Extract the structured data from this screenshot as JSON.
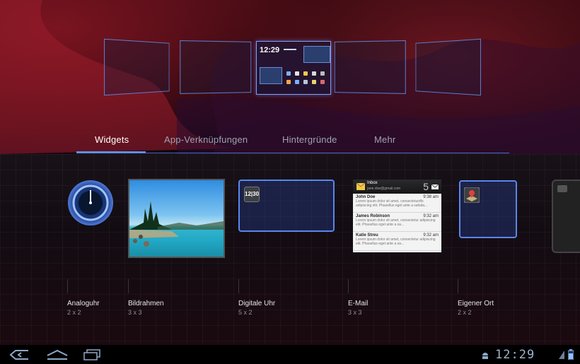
{
  "tabs": [
    {
      "label": "Widgets",
      "active": true
    },
    {
      "label": "App-Verknüpfungen",
      "active": false
    },
    {
      "label": "Hintergründe",
      "active": false
    },
    {
      "label": "Mehr",
      "active": false
    }
  ],
  "homescreen_preview": {
    "clock_text": "12:29"
  },
  "widgets": [
    {
      "name": "Analoguhr",
      "size": "2 x 2"
    },
    {
      "name": "Bildrahmen",
      "size": "3 x 3"
    },
    {
      "name": "Digitale Uhr",
      "size": "5 x 2",
      "clock_chip": "12|30"
    },
    {
      "name": "E-Mail",
      "size": "3 x 3"
    },
    {
      "name": "Eigener Ort",
      "size": "2 x 2"
    }
  ],
  "email_widget": {
    "inbox_title": "Inbox",
    "account": "jane.doe@gmail.com",
    "unread_count": "5",
    "messages": [
      {
        "from": "John Doe",
        "time": "9:38 am",
        "preview": "Lorem ipsum dolor sit amet, consecteturdfs adipiscing elit. Phasellus eget ante a safsda..."
      },
      {
        "from": "James Robinson",
        "time": "9:32 am",
        "preview": "Lorem ipsum dolor sit amet, consectetur adipiscing elit. Phasellus eget ante a sa..."
      },
      {
        "from": "Katie Streu",
        "time": "9:32 am",
        "preview": "Lorem ipsum dolor sit amet, consectetur adipiscing elit. Phasellus eget ante a sa..."
      }
    ]
  },
  "status_bar": {
    "time": "12:29"
  },
  "colors": {
    "accent": "#5e8fe6",
    "panel_border": "#6b8ad8"
  },
  "icons": {
    "back": "back-icon",
    "home": "home-icon",
    "recents": "recent-apps-icon",
    "android": "android-debug-icon",
    "battery": "battery-icon",
    "signal": "signal-icon"
  }
}
